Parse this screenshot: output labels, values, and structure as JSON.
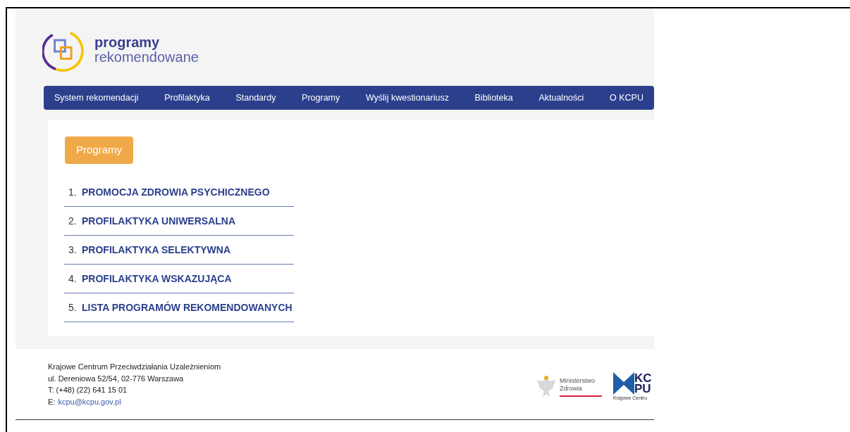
{
  "logo": {
    "line_1": "programy",
    "line_2": "rekomendowane"
  },
  "nav": [
    "System rekomendacji",
    "Profilaktyka",
    "Standardy",
    "Programy",
    "Wyślij kwestionariusz",
    "Biblioteka",
    "Aktualności",
    "O KCPU"
  ],
  "section_button": "Programy",
  "list": [
    {
      "number": "1.",
      "label": "PROMOCJA ZDROWIA PSYCHICZNEGO"
    },
    {
      "number": "2.",
      "label": "PROFILAKTYKA UNIWERSALNA"
    },
    {
      "number": "3.",
      "label": "PROFILAKTYKA SELEKTYWNA"
    },
    {
      "number": "4.",
      "label": "PROFILAKTYKA WSKAZUJĄCA"
    },
    {
      "number": "5.",
      "label": "LISTA PROGRAMÓW REKOMENDOWANYCH"
    }
  ],
  "footer": {
    "lines": [
      "Krajowe Centrum Przeciwdziałania Uzależnieniom",
      "ul. Dereniowa 52/54, 02-776 Warszawa",
      "T: (+48) (22) 641 15 01"
    ],
    "email_label": "E:",
    "email": "kcpu@kcpu.gov.pl",
    "ministry_logo": [
      "Ministerstwo",
      "Zdrowia"
    ],
    "kcpu_logo": {
      "line_1": "KC",
      "line_2": "PU",
      "caption": "Krajowe Centru"
    }
  }
}
